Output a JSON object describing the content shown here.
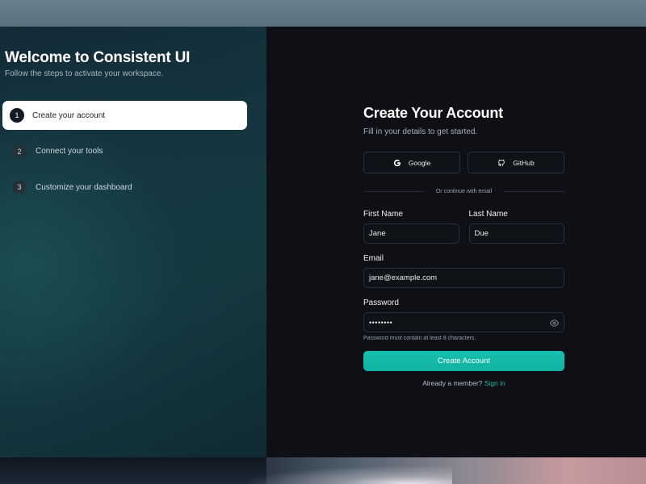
{
  "onboarding": {
    "title": "Welcome to Consistent UI",
    "subtitle": "Follow the steps to activate your workspace.",
    "steps": [
      {
        "number": "1",
        "label": "Create your account",
        "active": true
      },
      {
        "number": "2",
        "label": "Connect your tools",
        "active": false
      },
      {
        "number": "3",
        "label": "Customize your dashboard",
        "active": false
      }
    ]
  },
  "form": {
    "title": "Create Your Account",
    "subtitle": "Fill in your details to get started.",
    "oauth": {
      "google_label": "Google",
      "google_icon": "google-icon",
      "github_label": "GitHub",
      "github_icon": "github-icon"
    },
    "divider_text": "Or continue with email",
    "first_name": {
      "label": "First Name",
      "value": "Jane"
    },
    "last_name": {
      "label": "Last Name",
      "value": "Due"
    },
    "email": {
      "label": "Email",
      "value": "jane@example.com"
    },
    "password": {
      "label": "Password",
      "value": "••••••••",
      "toggle_icon": "eye-icon"
    },
    "password_hint": "Password must contain at least 8 characters.",
    "submit_label": "Create Account",
    "signin_prompt": "Already a member?",
    "signin_link": "Sign in"
  },
  "colors": {
    "accent": "#14b8a6",
    "link": "#22b7a5",
    "background": "#0e1015",
    "active_step_bg": "#ffffff"
  }
}
